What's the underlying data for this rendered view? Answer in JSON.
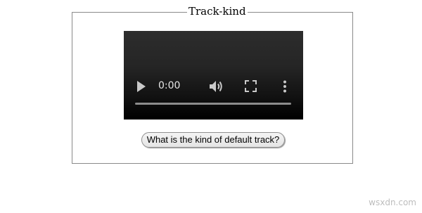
{
  "fieldset": {
    "legend": "Track-kind"
  },
  "video": {
    "current_time": "0:00",
    "progress_fraction": 0,
    "icons": {
      "play": "play-icon",
      "volume": "volume-icon",
      "fullscreen": "fullscreen-icon",
      "more": "more-vertical-icon"
    }
  },
  "button": {
    "label": "What is the kind of default track?"
  },
  "watermark": {
    "text": "wsxdn.com"
  },
  "colors": {
    "border": "#8a8a8a",
    "video_bg": "#000000",
    "control_icon": "#c9c9c9",
    "button_bg": "#e9e9e9",
    "watermark": "#bdbdbd"
  }
}
